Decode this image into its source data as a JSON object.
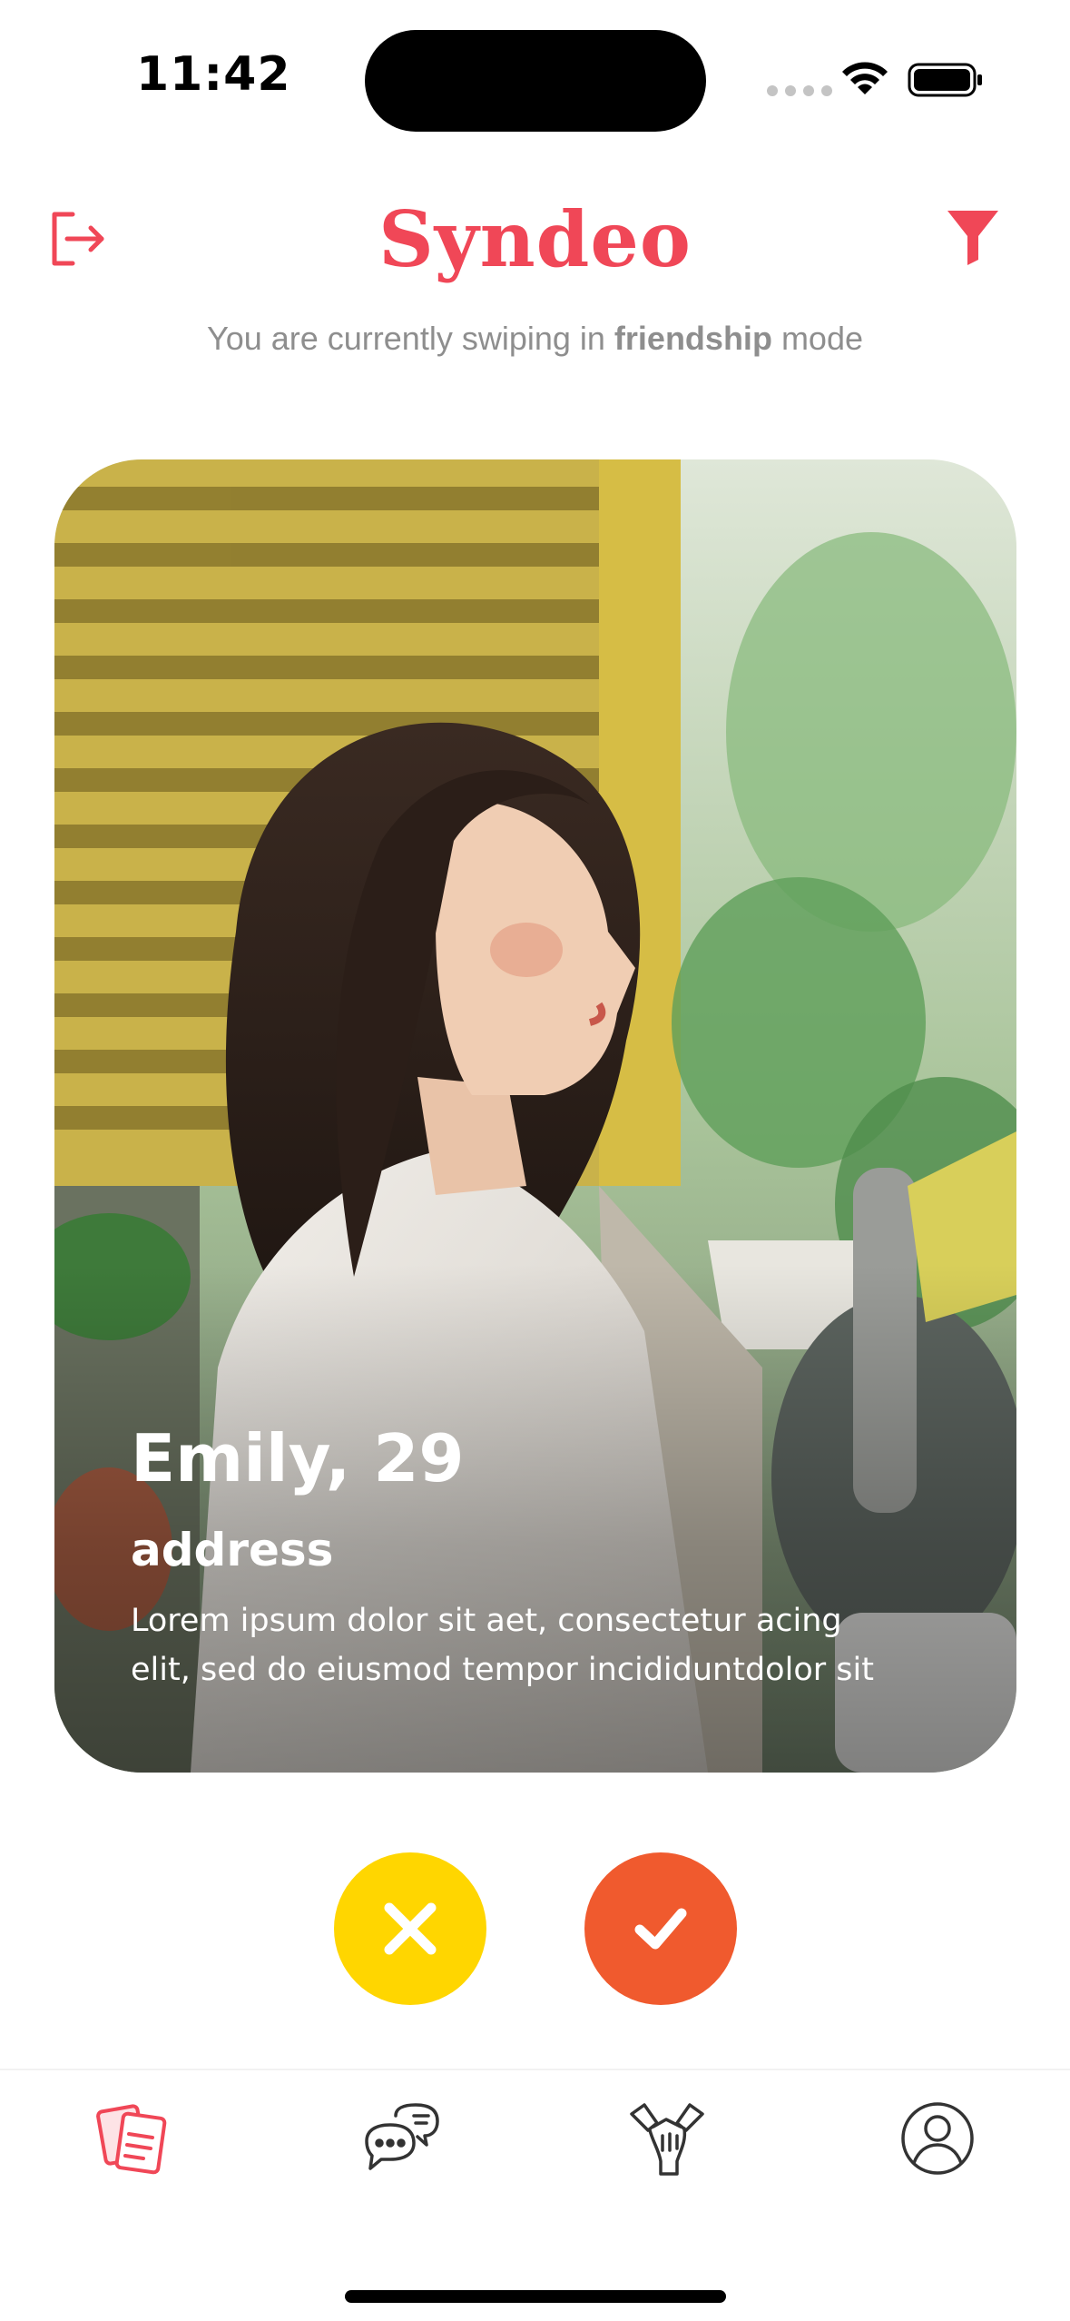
{
  "status_bar": {
    "time": "11:42"
  },
  "header": {
    "brand": "Syndeo",
    "mode_prefix": "You are currently swiping in ",
    "mode_value": "friendship",
    "mode_suffix": " mode"
  },
  "card": {
    "name_age": "Emily, 29",
    "address": "address",
    "bio_line1": "Lorem ipsum dolor sit aet, consectetur acing",
    "bio_line2": "elit, sed do eiusmod tempor incididuntdolor sit"
  },
  "actions": {
    "reject_icon": "close-icon",
    "accept_icon": "check-icon"
  },
  "tabs": [
    {
      "name": "cards-icon",
      "active": true
    },
    {
      "name": "chat-icon",
      "active": false
    },
    {
      "name": "friends-icon",
      "active": false
    },
    {
      "name": "profile-icon",
      "active": false
    }
  ],
  "colors": {
    "brand": "#f04757",
    "reject": "#ffd600",
    "accept": "#f05a2e",
    "muted_text": "#8e8e8e"
  }
}
